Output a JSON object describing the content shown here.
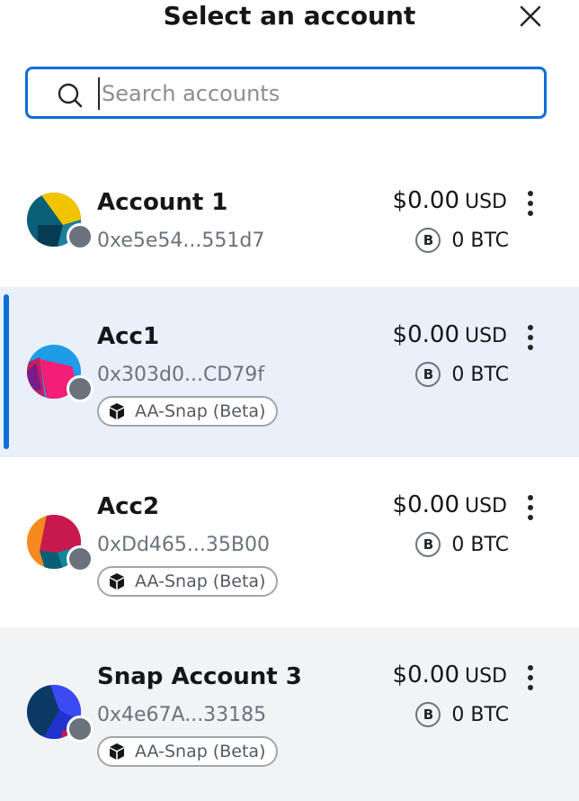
{
  "header": {
    "title": "Select an account",
    "close_icon": "close-icon"
  },
  "search": {
    "placeholder": "Search accounts",
    "value": "",
    "icon": "search-icon"
  },
  "accounts": [
    {
      "name": "Account 1",
      "address": "0xe5e54...551d7",
      "balance": "$0.00",
      "currency": "USD",
      "btc_badge": "B",
      "btc_balance": "0 BTC",
      "tag": "",
      "selected": false
    },
    {
      "name": "Acc1",
      "address": "0x303d0...CD79f",
      "balance": "$0.00",
      "currency": "USD",
      "btc_badge": "B",
      "btc_balance": "0 BTC",
      "tag": "AA-Snap (Beta)",
      "selected": true
    },
    {
      "name": "Acc2",
      "address": "0xDd465...35B00",
      "balance": "$0.00",
      "currency": "USD",
      "btc_badge": "B",
      "btc_balance": "0 BTC",
      "tag": "AA-Snap (Beta)",
      "selected": false
    },
    {
      "name": "Snap Account 3",
      "address": "0x4e67A...33185",
      "balance": "$0.00",
      "currency": "USD",
      "btc_badge": "B",
      "btc_balance": "0 BTC",
      "tag": "AA-Snap (Beta)",
      "selected": false
    }
  ],
  "colors": {
    "accent": "#0e6fd8",
    "selected_bg": "#e9f0fa",
    "hover_bg": "#f2f3f4",
    "status_dot": "#6a737d",
    "muted_text": "#6a737d"
  }
}
